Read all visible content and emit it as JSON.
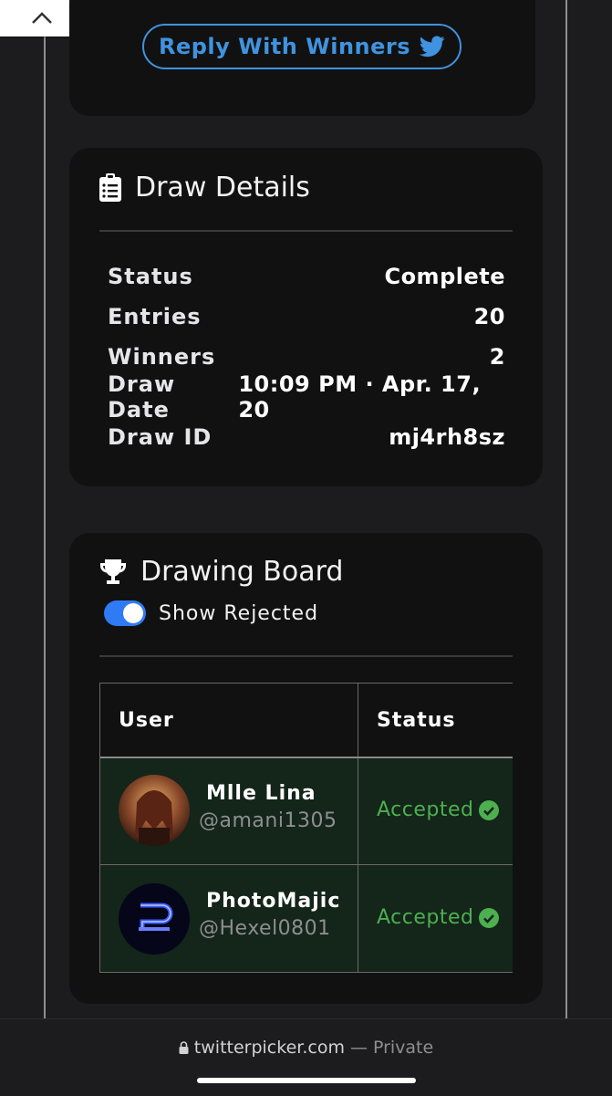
{
  "reply_button": {
    "label": "Reply With Winners"
  },
  "draw_details": {
    "title": "Draw Details",
    "rows": [
      {
        "key": "Status",
        "value": "Complete"
      },
      {
        "key": "Entries",
        "value": "20"
      },
      {
        "key": "Winners",
        "value": "2"
      },
      {
        "key": "Draw Date",
        "value": "10:09 PM · Apr. 17, 20"
      },
      {
        "key": "Draw ID",
        "value": "mj4rh8sz"
      }
    ]
  },
  "drawing_board": {
    "title": "Drawing Board",
    "toggle_label": "Show Rejected",
    "toggle_on": true,
    "columns": [
      "User",
      "Status"
    ],
    "rows": [
      {
        "name": "Mlle Lina",
        "handle": "@amani1305",
        "status": "Accepted"
      },
      {
        "name": "PhotoMajic",
        "handle": "@Hexel0801",
        "status": "Accepted"
      }
    ]
  },
  "browser": {
    "domain": "twitterpicker.com",
    "separator": "—",
    "mode": "Private"
  },
  "colors": {
    "accent": "#3f93e0",
    "accepted": "#4caf50",
    "toggle": "#2f7bf5"
  }
}
